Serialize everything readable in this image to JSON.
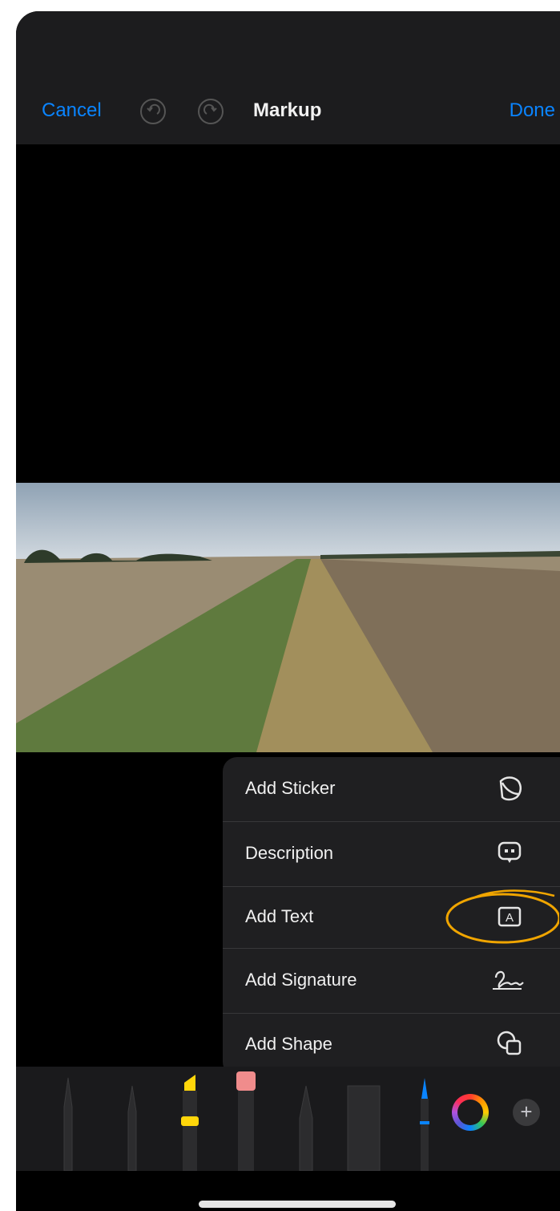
{
  "nav": {
    "cancel": "Cancel",
    "title": "Markup",
    "done": "Done",
    "undo_icon": "undo-icon",
    "redo_icon": "redo-icon"
  },
  "menu": {
    "items": [
      {
        "label": "Add Sticker",
        "icon": "sticker-icon"
      },
      {
        "label": "Description",
        "icon": "speech-bubble-icon"
      },
      {
        "label": "Add Text",
        "icon": "text-box-icon"
      },
      {
        "label": "Add Signature",
        "icon": "signature-icon"
      },
      {
        "label": "Add Shape",
        "icon": "shapes-icon"
      }
    ]
  },
  "toolbar": {
    "tools": [
      "pen",
      "monoline",
      "highlighter",
      "eraser",
      "pencil",
      "ruler",
      "fountain-pen"
    ],
    "add_button": "+"
  },
  "colors": {
    "accent": "#0a84ff",
    "annotation": "#f0a500",
    "menu_bg": "#1f1f21"
  }
}
